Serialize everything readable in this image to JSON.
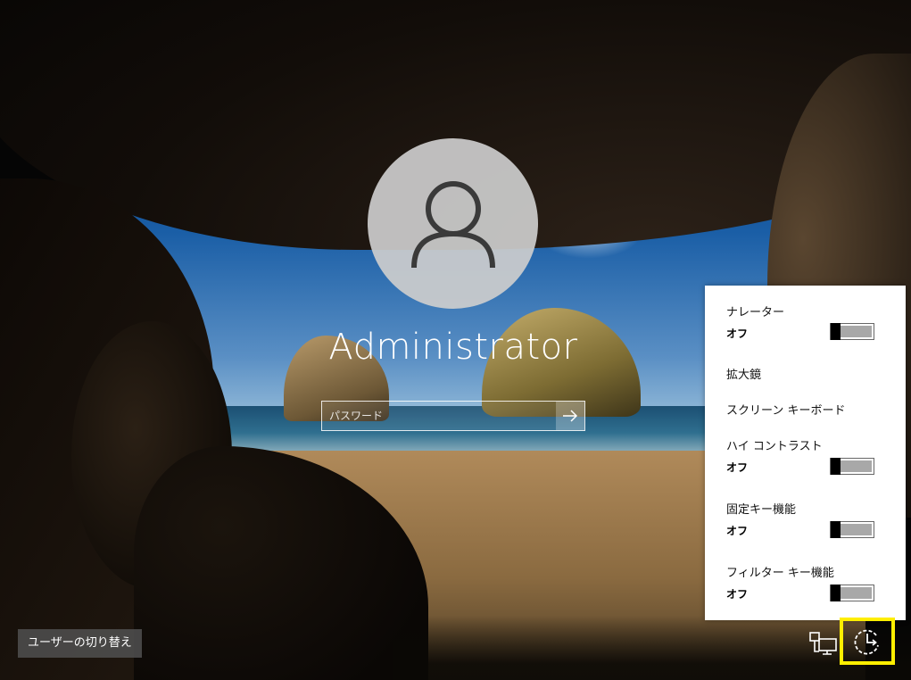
{
  "login": {
    "username": "Administrator",
    "password_placeholder": "パスワード",
    "password_value": ""
  },
  "switch_user_label": "ユーザーの切り替え",
  "ease_of_access": {
    "items": [
      {
        "label": "ナレーター",
        "state": "オフ",
        "has_toggle": true
      },
      {
        "label": "拡大鏡",
        "has_toggle": false
      },
      {
        "label": "スクリーン キーボード",
        "has_toggle": false
      },
      {
        "label": "ハイ コントラスト",
        "state": "オフ",
        "has_toggle": true
      },
      {
        "label": "固定キー機能",
        "state": "オフ",
        "has_toggle": true
      },
      {
        "label": "フィルター キー機能",
        "state": "オフ",
        "has_toggle": true
      }
    ]
  },
  "icons": {
    "avatar": "user-silhouette-icon",
    "submit": "arrow-right-icon",
    "network": "network-icon",
    "ease_of_access": "ease-of-access-icon"
  },
  "colors": {
    "highlight": "#ffee00",
    "flyout_bg": "#ffffff",
    "toggle_knob": "#000000",
    "toggle_track": "#a8a8a8"
  }
}
